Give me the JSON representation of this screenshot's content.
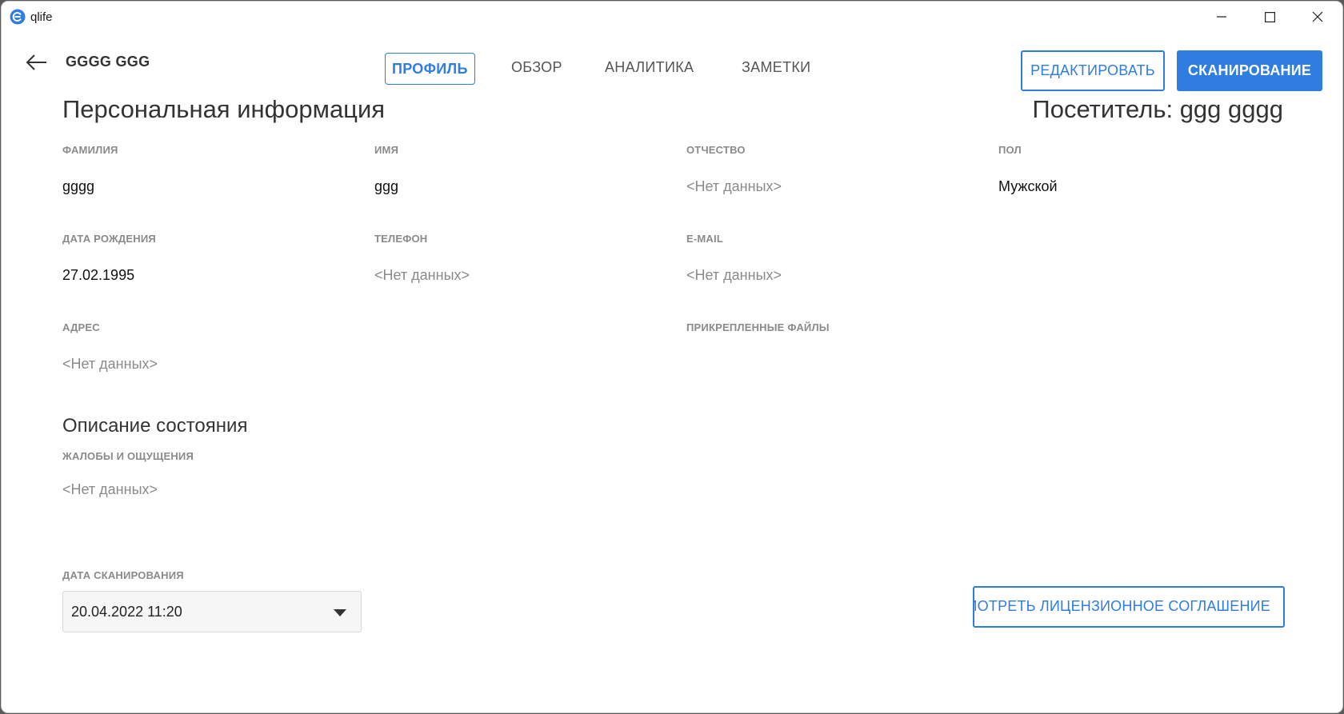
{
  "window": {
    "title": "qlife"
  },
  "header": {
    "patient_name": "GGGG GGG",
    "tabs": [
      {
        "label": "ПРОФИЛЬ",
        "active": true
      },
      {
        "label": "ОБЗОР",
        "active": false
      },
      {
        "label": "АНАЛИТИКА",
        "active": false
      },
      {
        "label": "ЗАМЕТКИ",
        "active": false
      }
    ],
    "edit_label": "РЕДАКТИРОВАТЬ",
    "scan_label": "СКАНИРОВАНИЕ"
  },
  "personal": {
    "title": "Персональная информация",
    "visitor": "Посетитель: ggg gggg",
    "fields": {
      "last_name": {
        "label": "ФАМИЛИЯ",
        "value": "gggg"
      },
      "first_name": {
        "label": "ИМЯ",
        "value": "ggg"
      },
      "patronymic": {
        "label": "ОТЧЕСТВО",
        "value": "<Нет данных>"
      },
      "gender": {
        "label": "ПОЛ",
        "value": "Мужской"
      },
      "birth_date": {
        "label": "ДАТА РОЖДЕНИЯ",
        "value": "27.02.1995"
      },
      "phone": {
        "label": "ТЕЛЕФОН",
        "value": "<Нет данных>"
      },
      "email": {
        "label": "E-MAIL",
        "value": "<Нет данных>"
      },
      "address": {
        "label": "АДРЕС",
        "value": "<Нет данных>"
      },
      "attachments": {
        "label": "ПРИКРЕПЛЕННЫЕ ФАЙЛЫ"
      }
    }
  },
  "condition": {
    "title": "Описание состояния",
    "complaints_label": "ЖАЛОБЫ И ОЩУЩЕНИЯ",
    "complaints_value": "<Нет данных>"
  },
  "scan": {
    "date_label": "ДАТА СКАНИРОВАНИЯ",
    "selected_date": "20.04.2022 11:20"
  },
  "license_button": "ПРОСМОТРЕТЬ ЛИЦЕНЗИОННОЕ СОГЛАШЕНИЕ",
  "colors": {
    "accent": "#2f7de0",
    "muted": "#8a8a8a"
  }
}
